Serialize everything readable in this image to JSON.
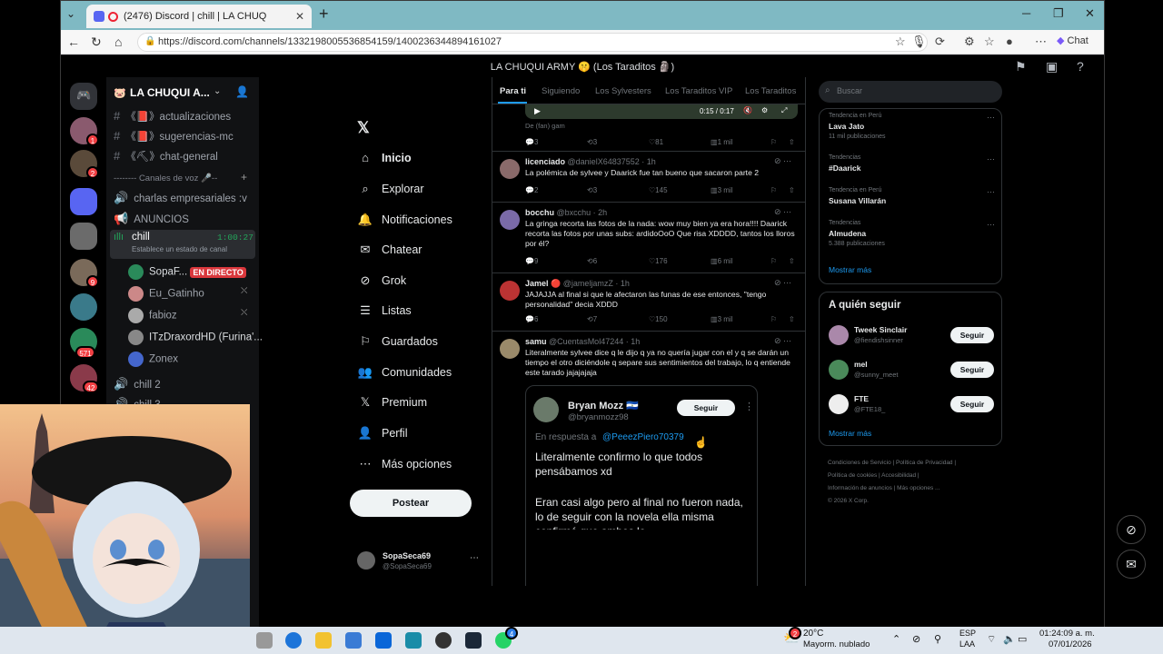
{
  "browser": {
    "tab_title": "(2476) Discord | chill | LA CHUQ",
    "tab_close": "✕",
    "new_tab": "+",
    "url": "https://discord.com/channels/1332198005536854159/1400236344894161027",
    "chat_label": "Chat"
  },
  "discord": {
    "window_title": "LA CHUQUI ARMY 🤫 (Los Taraditos 🗿)",
    "server_name": "LA CHUQUI A...",
    "badges": [
      "1",
      "2",
      "9",
      "571",
      "42"
    ],
    "channels": [
      {
        "label": "《📕》actualizaciones"
      },
      {
        "label": "《📕》sugerencias-mc"
      },
      {
        "label": "《⛏》chat-general"
      }
    ],
    "voice_category": "-------- Canales de voz 🎤--",
    "voice_channels": [
      "charlas empresariales :v",
      "ANUNCIOS"
    ],
    "active_vc": {
      "name": "chill",
      "timer": "1:00:27",
      "status": "Establece un estado de canal"
    },
    "members": [
      {
        "name": "SopaF...",
        "live": "EN DIRECTO"
      },
      {
        "name": "Eu_Gatinho"
      },
      {
        "name": "fabioz"
      },
      {
        "name": "ITzDraxordHD (Furina'..."
      },
      {
        "name": "Zonex"
      }
    ],
    "more_vc": [
      "chill 2",
      "chill 3"
    ]
  },
  "x": {
    "nav": [
      "Inicio",
      "Explorar",
      "Notificaciones",
      "Chatear",
      "Grok",
      "Listas",
      "Guardados",
      "Comunidades",
      "Premium",
      "Perfil",
      "Más opciones"
    ],
    "post_button": "Postear",
    "profile": {
      "name": "SopaSeca69",
      "handle": "@SopaSeca69"
    },
    "feed_tabs": [
      "Para ti",
      "Siguiendo",
      "Los Sylvesters",
      "Los Taraditos VIP",
      "Los Taraditos"
    ],
    "video": {
      "time": "0:15 / 0:17",
      "by": "De (fan) gam"
    },
    "video_stats": [
      "3",
      "3",
      "81",
      "1 mil"
    ],
    "tweets": [
      {
        "name": "licenciado",
        "handle": "@danielX64837552 · 1h",
        "text": "La polémica de sylvee y Daarick fue tan bueno que sacaron parte 2",
        "stats": [
          "2",
          "3",
          "145",
          "3 mil"
        ]
      },
      {
        "name": "bocchu",
        "handle": "@bxcchu · 2h",
        "text": "La gringa recorta las fotos de la nada: wow muy bien ya era hora!!!! Daarick recorta las fotos por unas subs: ardidoOoO Que risa XDDDD, tantos los lloros por él?",
        "stats": [
          "9",
          "6",
          "176",
          "6 mil"
        ]
      },
      {
        "name": "Jamel 🔴",
        "handle": "@jameljamzZ · 1h",
        "text": "JAJAJJA al final si que le afectaron las funas de ese entonces, \"tengo personalidad\" decia XDDD",
        "stats": [
          "6",
          "7",
          "150",
          "3 mil"
        ]
      },
      {
        "name": "samu",
        "handle": "@CuentasMol47244 · 1h",
        "text": "Literalmente sylvee dice q le dijo q ya no quería jugar con el y q se darán un tiempo el otro diciéndole q separe sus sentimientos del trabajo, lo q entiende este tarado jajajajaja"
      }
    ],
    "quote": {
      "name": "Bryan Mozz 🇸🇻",
      "handle": "@bryanmozz98",
      "follow": "Seguir",
      "reply_to_label": "En respuesta a",
      "reply_to": "@PeeezPiero70379",
      "text1": "Literalmente confirmo lo que todos pensábamos xd",
      "text2": "Eran casi algo pero al final no fueron nada, lo de seguir con la novela ella misma confirmó que ambos lo"
    },
    "search_placeholder": "Buscar",
    "trends": [
      {
        "cat": "Tendencia en Perú",
        "name": "Lava Jato",
        "sub": "11 mil publicaciones"
      },
      {
        "cat": "Tendencias",
        "name": "#Daarick",
        "sub": ""
      },
      {
        "cat": "Tendencia en Perú",
        "name": "Susana Villarán",
        "sub": ""
      },
      {
        "cat": "Tendencias",
        "name": "Almudena",
        "sub": "5.388 publicaciones"
      }
    ],
    "show_more": "Mostrar más",
    "who_to_follow": "A quién seguir",
    "suggestions": [
      {
        "name": "Tweek Sinclair",
        "handle": "@fiendishsinner",
        "btn": "Seguir"
      },
      {
        "name": "mel",
        "handle": "@sunny_meet",
        "btn": "Seguir"
      },
      {
        "name": "FTE",
        "handle": "@FTE18_",
        "btn": "Seguir"
      }
    ],
    "footer": [
      "Condiciones de Servicio",
      "Política de Privacidad",
      "Política de cookies",
      "Accesibilidad",
      "Información de anuncios",
      "Más opciones ...",
      "© 2026 X Corp."
    ]
  },
  "taskbar": {
    "temp": "20°C",
    "weather": "Mayorm. nublado",
    "lang1": "ESP",
    "lang2": "LAA",
    "time": "01:24:09 a. m.",
    "date": "07/01/2026",
    "weather_badge": "2",
    "whatsapp_badge": "4"
  },
  "colors": {
    "accent": "#1d9bf0",
    "discord_green": "#23a55a",
    "live_red": "#da373c"
  }
}
